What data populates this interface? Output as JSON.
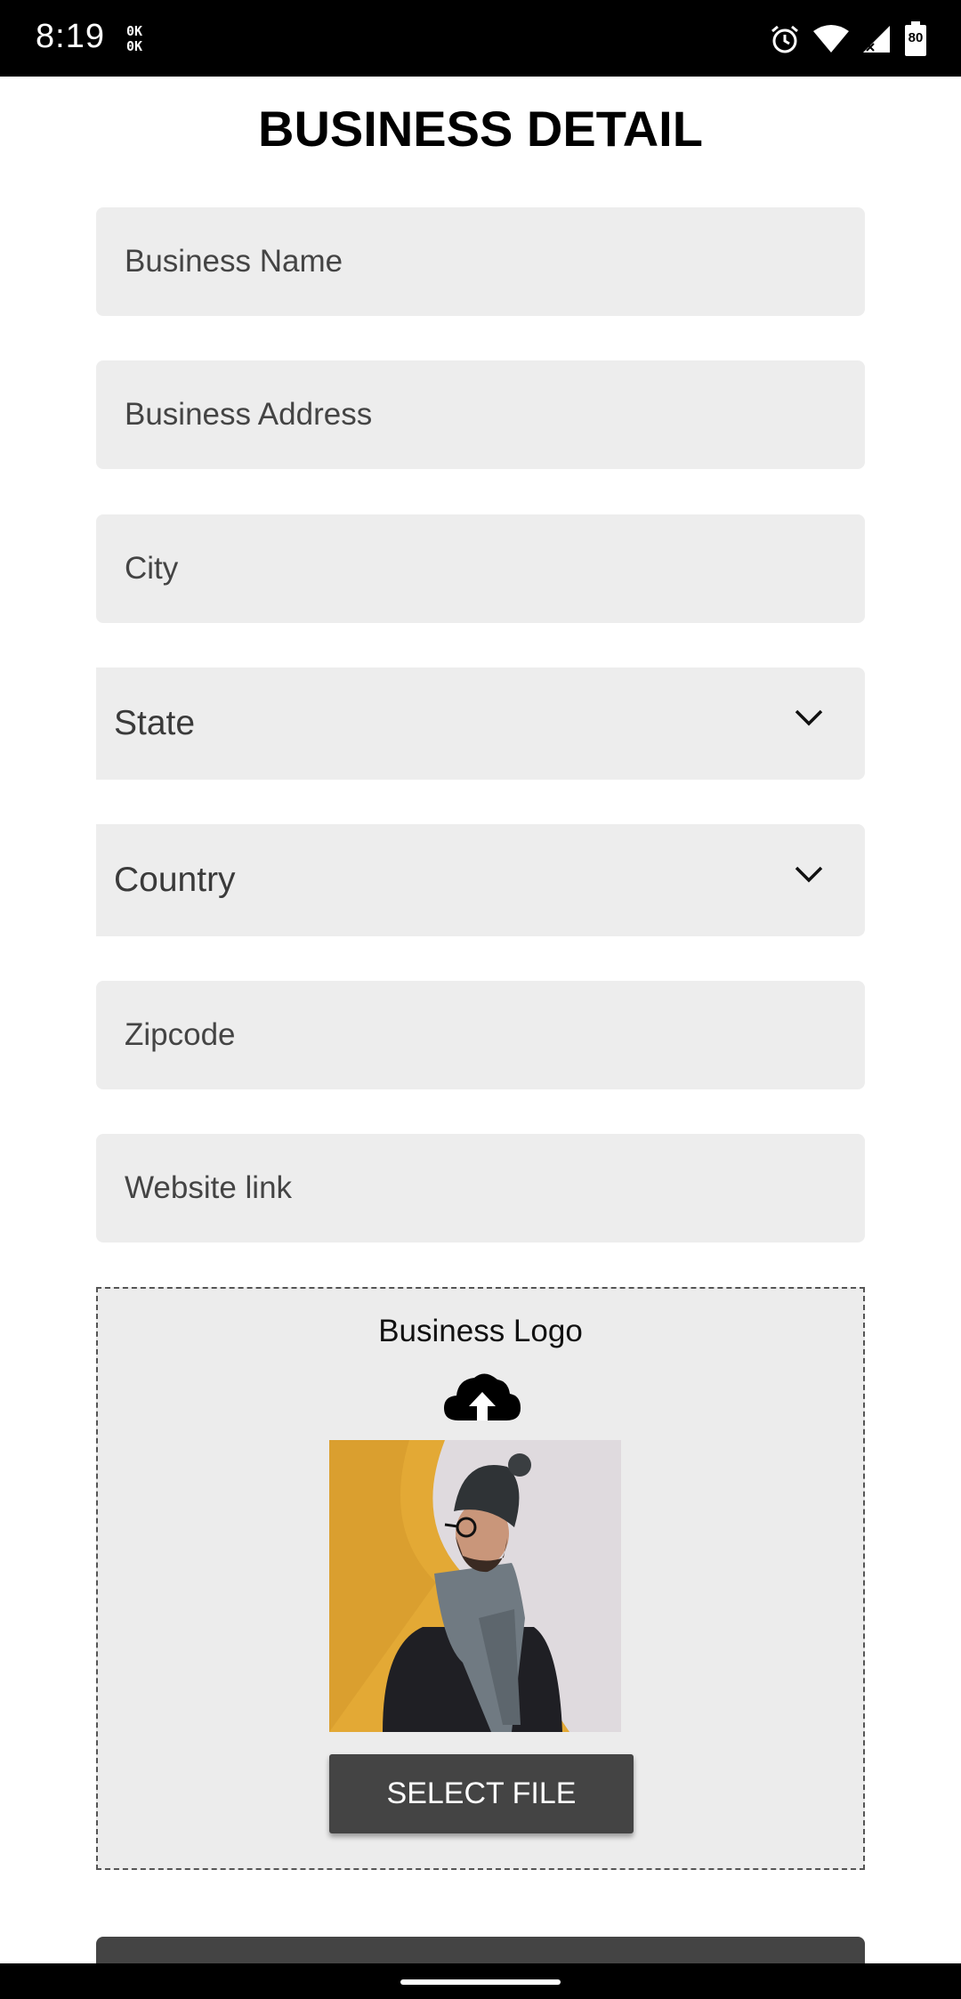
{
  "status_bar": {
    "time": "8:19",
    "notif_line1": "0K",
    "notif_line2": "0K",
    "battery": "80",
    "icons": [
      "alarm-icon",
      "wifi-icon",
      "signal-icon",
      "battery-icon"
    ]
  },
  "page": {
    "title": "BUSINESS DETAIL"
  },
  "form": {
    "business_name": {
      "value": "",
      "placeholder": "Business Name"
    },
    "business_address": {
      "value": "",
      "placeholder": "Business Address"
    },
    "city": {
      "value": "",
      "placeholder": "City"
    },
    "state": {
      "selected": "State"
    },
    "country": {
      "selected": "Country"
    },
    "zipcode": {
      "value": "",
      "placeholder": "Zipcode"
    },
    "website": {
      "value": "",
      "placeholder": "Website link"
    }
  },
  "logo": {
    "title": "Business Logo",
    "icon": "cloud-upload-icon",
    "button_label": "SELECT FILE"
  },
  "colors": {
    "field_bg": "#ededed",
    "button_bg": "#444444",
    "photo_yellow": "#e8b030"
  }
}
